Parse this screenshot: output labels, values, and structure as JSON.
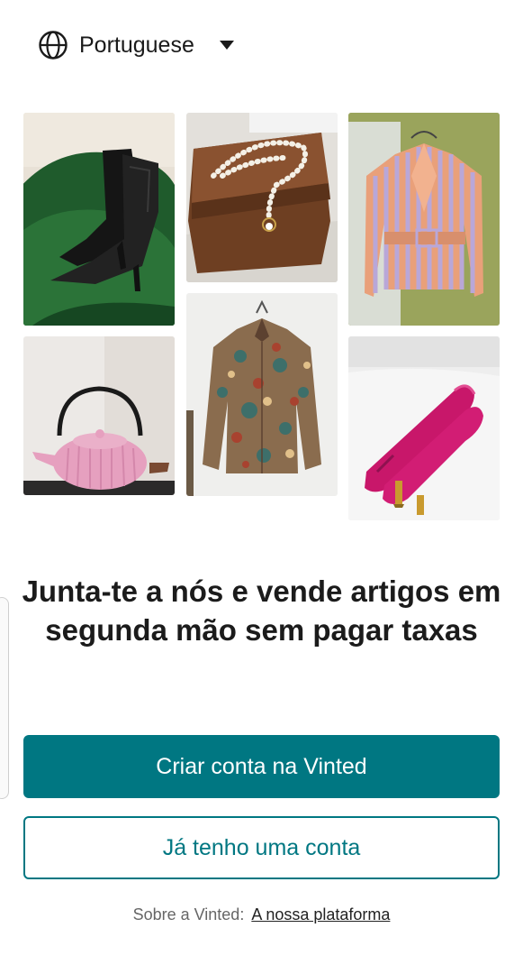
{
  "language": {
    "label": "Portuguese",
    "globe_icon": "globe-icon",
    "dropdown_icon": "caret-down-icon"
  },
  "gallery": {
    "items": [
      "green chair with black leather boots",
      "wooden box with pearl necklace",
      "orange and lilac striped blazer",
      "pink cast-iron teapot",
      "paisley print shirt on hanger",
      "fuchsia pointed slingback heels"
    ]
  },
  "headline": "Junta-te a nós e vende artigos em segunda mão sem pagar taxas",
  "buttons": {
    "signup": "Criar conta na Vinted",
    "login": "Já tenho uma conta"
  },
  "footer": {
    "prefix": "Sobre a Vinted:",
    "link": "A nossa plataforma"
  },
  "colors": {
    "brand": "#007782",
    "text": "#1b1b1b",
    "muted": "#666666"
  }
}
